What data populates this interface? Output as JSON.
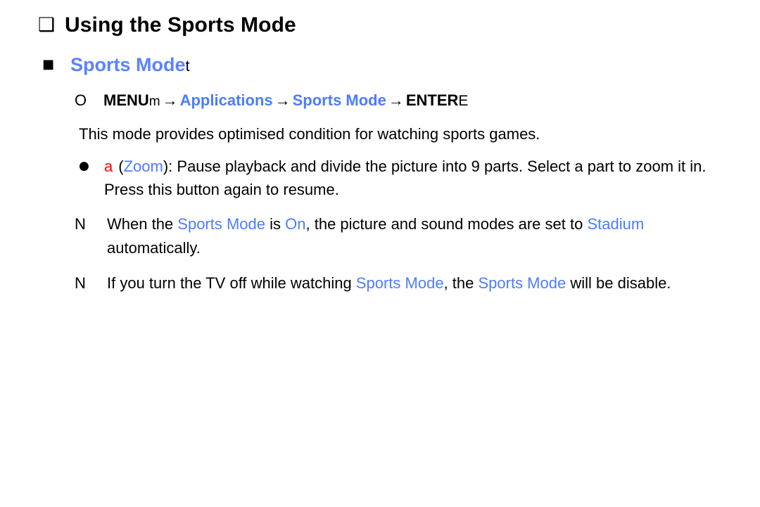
{
  "colors": {
    "link_blue": "#4d7cfe",
    "heading_blue": "#5b82ff",
    "alert_red": "#ff0000",
    "text_black": "#000000",
    "background": "#ffffff"
  },
  "title": {
    "bullet_icon": "❑",
    "text": "Using the Sports Mode"
  },
  "subheading": {
    "bullet_icon": "■",
    "text": "Sports Mode",
    "key_glyph": "t"
  },
  "menu_path": {
    "marker_icon": "O",
    "menu_label": "MENU",
    "menu_glyph": "m",
    "arrow": "→",
    "step1": "Applications",
    "step2": "Sports Mode",
    "enter_label": "ENTER",
    "enter_glyph": "E"
  },
  "description": "This mode provides optimised condition for watching sports games.",
  "zoom_bullet": {
    "marker_icon": "●",
    "key_letter": "a",
    "paren_open": "(",
    "zoom_label": "Zoom",
    "paren_close_colon": "): ",
    "line1_rest": "Pause playback and divide the picture into 9 parts. Select a part",
    "line2": "to zoom it in. Press this button again to resume."
  },
  "notes": [
    {
      "marker_icon": "N",
      "part1": "When the ",
      "highlight1": "Sports Mode",
      "part2": " is ",
      "highlight2": "On",
      "part3": ", the picture and sound modes are set to",
      "highlight3": "Stadium",
      "part4": " automatically."
    },
    {
      "marker_icon": "N",
      "part1": "If you turn the TV off while watching ",
      "highlight1": "Sports Mode",
      "part2": ", the ",
      "highlight2": "Sports Mode",
      "part3": " will be",
      "part4": "disable."
    }
  ]
}
